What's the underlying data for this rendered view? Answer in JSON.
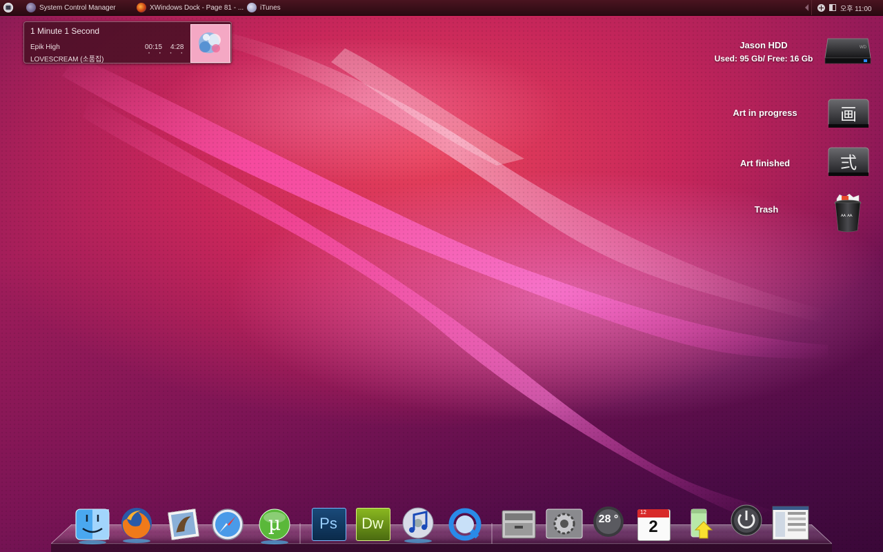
{
  "taskbar": {
    "tasks": [
      {
        "label": "System Control Manager",
        "icon": "gear-globe-icon"
      },
      {
        "label": "XWindows Dock - Page 81 - ...",
        "icon": "firefox-icon"
      },
      {
        "label": "iTunes",
        "icon": "itunes-icon"
      }
    ],
    "clock": "오후 11:00"
  },
  "now_playing": {
    "title": "1 Minute 1 Second",
    "artist": "Epik High",
    "album": "LOVESCREAM (소품집)",
    "elapsed": "00:15",
    "total": "4:28",
    "rating_dots": "• • • • •"
  },
  "desktop": {
    "hdd": {
      "name": "Jason HDD",
      "usage": "Used: 95 Gb/ Free: 16 Gb"
    },
    "art_in_progress": {
      "label": "Art in progress",
      "glyph": "画"
    },
    "art_finished": {
      "label": "Art finished",
      "glyph": "弍"
    },
    "trash": {
      "label": "Trash"
    }
  },
  "dock": {
    "items": [
      {
        "name": "finder-icon"
      },
      {
        "name": "firefox-icon"
      },
      {
        "name": "mail-icon"
      },
      {
        "name": "safari-icon"
      },
      {
        "name": "utorrent-icon",
        "glyph": "µ"
      },
      {
        "name": "photoshop-icon",
        "text": "Ps"
      },
      {
        "name": "dreamweaver-icon",
        "text": "Dw"
      },
      {
        "name": "itunes-icon"
      },
      {
        "name": "quicktime-icon"
      },
      {
        "name": "archive-icon"
      },
      {
        "name": "system-preferences-icon"
      },
      {
        "name": "weather-icon",
        "text": "28 °"
      },
      {
        "name": "calendar-icon",
        "month": "12",
        "day": "2"
      },
      {
        "name": "upload-icon"
      },
      {
        "name": "power-icon"
      },
      {
        "name": "screen-thumbnail-icon"
      }
    ]
  },
  "colors": {
    "accent": "#e8425a",
    "photoshop_bg": "#0a2a4a",
    "dreamweaver_bg": "#5a7a10"
  }
}
